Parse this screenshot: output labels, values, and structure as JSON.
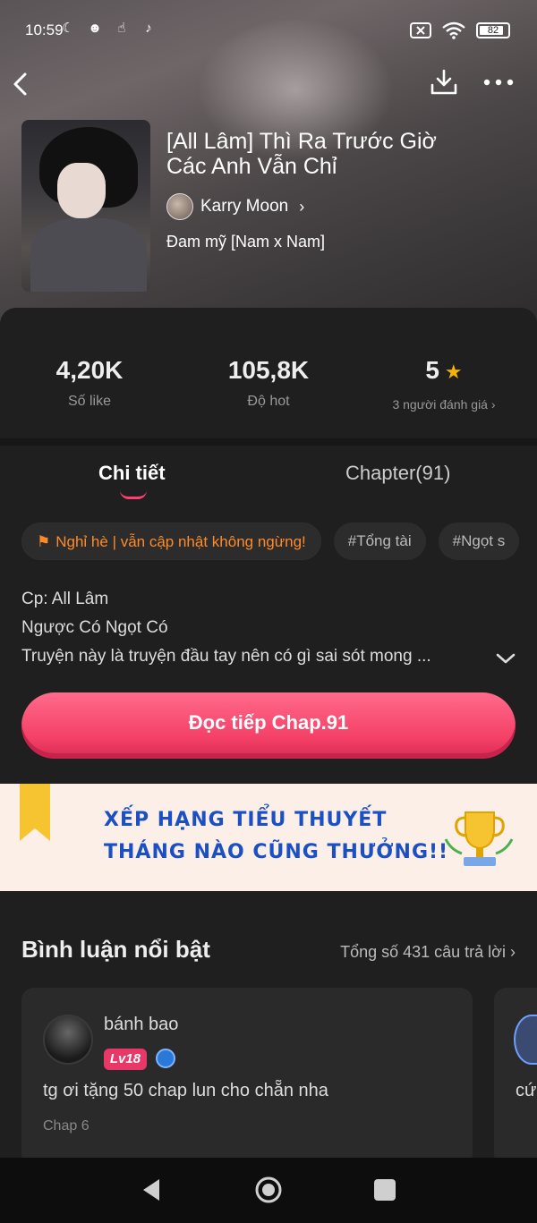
{
  "status": {
    "time": "10:59",
    "battery": "82",
    "icons": [
      "moon-icon",
      "wallet-icon",
      "tap-icon",
      "tiktok-icon",
      "sim-off-icon",
      "wifi-icon",
      "battery-icon"
    ]
  },
  "header": {
    "back_icon": "chevron-left-icon",
    "download_icon": "download-icon",
    "more_icon": "more-dots-icon"
  },
  "book": {
    "title": "[All Lâm] Thì Ra Trước Giờ Các Anh Vẫn Chỉ",
    "author": "Karry Moon",
    "genre": "Đam mỹ [Nam x Nam]"
  },
  "stats": {
    "likes_value": "4,20K",
    "likes_label": "Số like",
    "hot_value": "105,8K",
    "hot_label": "Độ hot",
    "rating_value": "5",
    "rating_label": "3 người đánh giá"
  },
  "tabs": {
    "detail": "Chi tiết",
    "chapters": "Chapter(91)"
  },
  "chips": {
    "promo": "Nghỉ hè | vẫn cập nhật không ngừng!",
    "tag1": "#Tổng tài",
    "tag2": "#Ngọt s"
  },
  "description": {
    "line1": "Cp: All Lâm",
    "line2": "Ngược Có Ngọt Có",
    "line3": "Truyện này là truyện đầu tay nên có gì sai sót mong ..."
  },
  "read_button": "Đọc tiếp Chap.91",
  "banner": {
    "line1": "XẾP HẠNG TIỂU THUYẾT",
    "line2": "THÁNG NÀO CŨNG THƯỞNG!!"
  },
  "comments": {
    "heading": "Bình luận nổi bật",
    "total": "Tổng số 431 câu trả lời",
    "items": [
      {
        "user": "bánh bao",
        "level": "Lv18",
        "text": "tg ơi tặng 50 chap lun cho chẵn nha",
        "chapter": "Chap 6"
      },
      {
        "text": "cứ"
      }
    ]
  },
  "colors": {
    "accent": "#f43f66",
    "star": "#f5b400",
    "promo": "#ff8a2a",
    "banner_text": "#1b4fc4"
  }
}
